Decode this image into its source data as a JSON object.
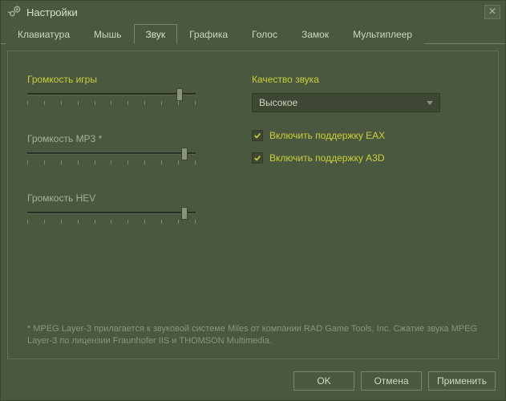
{
  "window": {
    "title": "Настройки"
  },
  "tabs": {
    "t0": "Клавиатура",
    "t1": "Мышь",
    "t2": "Звук",
    "t3": "Графика",
    "t4": "Голос",
    "t5": "Замок",
    "t6": "Мультиплеер"
  },
  "sliders": {
    "game": {
      "label": "Громкость игры",
      "pos": 92
    },
    "mp3": {
      "label": "Громкость MP3 *",
      "pos": 95
    },
    "hev": {
      "label": "Громкость HEV",
      "pos": 95
    }
  },
  "quality": {
    "label": "Качество звука",
    "value": "Высокое"
  },
  "checks": {
    "eax": "Включить поддержку EAX",
    "a3d": "Включить поддержку A3D"
  },
  "footnote": "* MPEG Layer-3 прилагается к звуковой системе Miles от компании RAD Game Tools, Inc. Сжатие звука MPEG Layer-3 по лицензии Fraunhofer IIS и THOMSON Multimedia.",
  "buttons": {
    "ok": "OK",
    "cancel": "Отмена",
    "apply": "Применить"
  }
}
